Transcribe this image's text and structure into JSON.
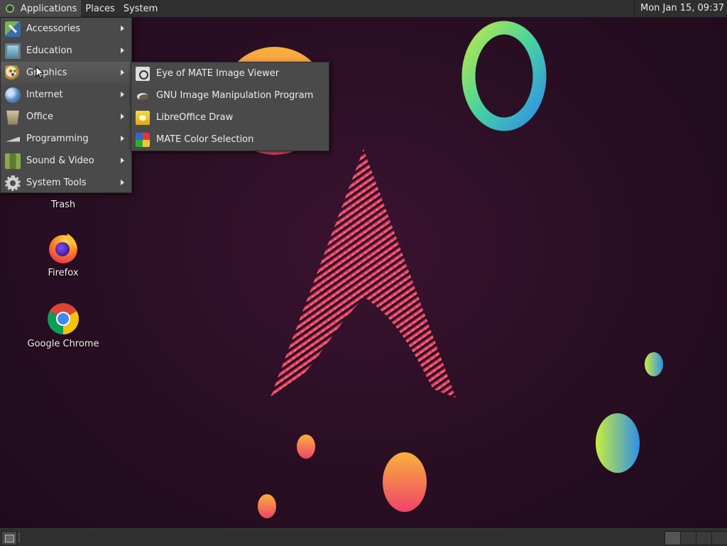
{
  "top_panel": {
    "menus": [
      "Applications",
      "Places",
      "System"
    ],
    "clock": "Mon Jan 15, 09:37"
  },
  "desktop": {
    "icons": [
      {
        "label": "Trash",
        "icon": "trash-icon"
      },
      {
        "label": "Firefox",
        "icon": "firefox-icon"
      },
      {
        "label": "Google Chrome",
        "icon": "chrome-icon"
      }
    ]
  },
  "applications_menu": {
    "items": [
      {
        "label": "Accessories",
        "icon": "accessories-icon"
      },
      {
        "label": "Education",
        "icon": "education-icon"
      },
      {
        "label": "Graphics",
        "icon": "graphics-icon",
        "highlighted": true
      },
      {
        "label": "Internet",
        "icon": "internet-icon"
      },
      {
        "label": "Office",
        "icon": "office-icon"
      },
      {
        "label": "Programming",
        "icon": "programming-icon"
      },
      {
        "label": "Sound & Video",
        "icon": "sound-video-icon"
      },
      {
        "label": "System Tools",
        "icon": "system-tools-icon"
      }
    ]
  },
  "graphics_submenu": {
    "items": [
      {
        "label": "Eye of MATE Image Viewer",
        "icon": "image-viewer-icon"
      },
      {
        "label": "GNU Image Manipulation Program",
        "icon": "gimp-icon"
      },
      {
        "label": "LibreOffice Draw",
        "icon": "libreoffice-draw-icon"
      },
      {
        "label": "MATE Color Selection",
        "icon": "color-selection-icon"
      }
    ]
  },
  "colors": {
    "panel": "#2f2f2f",
    "menu_bg": "#4a4a4a",
    "wallpaper_bg": "#2b0f24",
    "accent_pink": "#e8336e",
    "accent_orange": "#f7a23b"
  }
}
